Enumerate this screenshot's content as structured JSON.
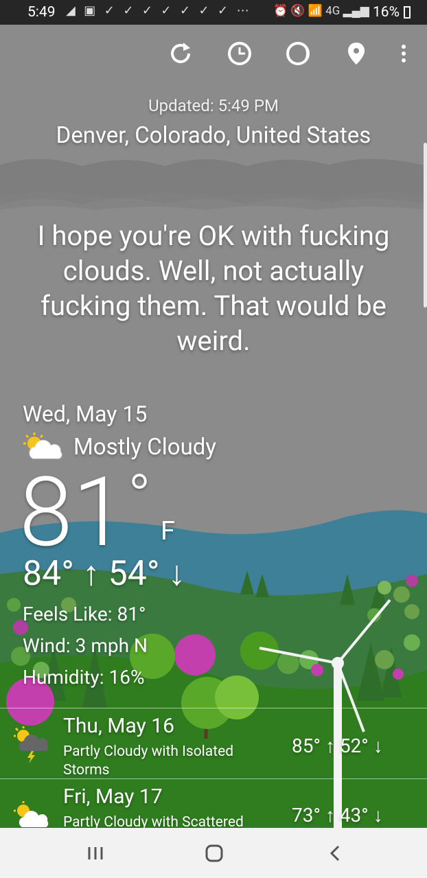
{
  "status_bar": {
    "time": "5:49",
    "notif_icons": "◢ ▣ ✓ ✓ ✓ ✓ ✓ ✓ ✓ ⋯",
    "sys_icons": "⏰ 🔇 📶 4G ▂▄▆",
    "battery": "16%"
  },
  "toolbar": {
    "refresh_icon": "refresh-icon",
    "hourly_icon": "hourly-icon",
    "moon_icon": "moon-phase-icon",
    "location_icon": "location-pin-icon",
    "menu_icon": "more-vert-icon"
  },
  "header": {
    "updated": "Updated: 5:49 PM",
    "location": "Denver, Colorado, United States"
  },
  "quote": "I hope you're OK with fucking clouds. Well, not actually fucking them. That would be weird.",
  "current": {
    "date": "Wed, May 15",
    "condition": "Mostly Cloudy",
    "temp": "81",
    "deg": "°",
    "unit": "F",
    "hilo": "84° ↑ 54° ↓",
    "feels_like": "Feels Like: 81°",
    "wind": "Wind: 3 mph N",
    "humidity": "Humidity: 16%"
  },
  "forecast": [
    {
      "date": "Thu, May 16",
      "desc": "Partly Cloudy with Isolated Storms",
      "temps": "85° ↑ 52° ↓"
    },
    {
      "date": "Fri, May 17",
      "desc": "Partly Cloudy with Scattered",
      "temps": "73° ↑ 43° ↓"
    }
  ],
  "colors": {
    "sky": "#8a8a8a",
    "hills_blue": "#3b7f92",
    "grass": "#2f7d1e",
    "tree_pink": "#c43fae",
    "tree_green": "#5aa82a"
  }
}
